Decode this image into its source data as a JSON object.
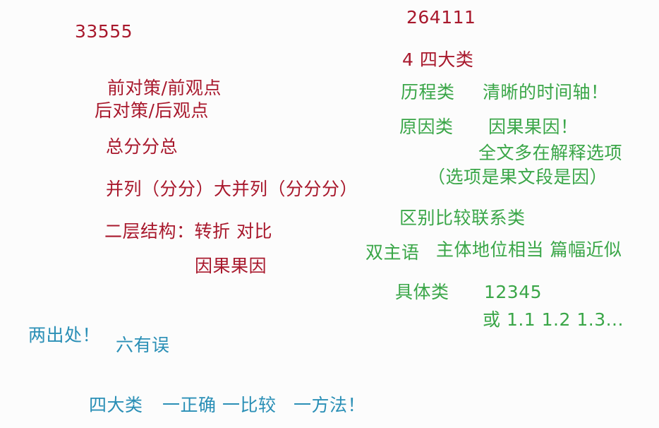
{
  "notes": {
    "left": {
      "num": "33555",
      "front_back_1": "前对策/前观点",
      "front_back_2": "后对策/后观点",
      "total_sub": "总分分总",
      "parallel": "并列（分分）大并列（分分分）",
      "two_layer": "二层结构：转折 对比",
      "cause_effect": "因果果因"
    },
    "right": {
      "num": "264111",
      "four_types": "4 四大类",
      "history_type": "历程类",
      "timeline": "清晰的时间轴！",
      "cause_type": "原因类",
      "cause_effect": "因果果因！",
      "explain_options": "全文多在解释选项",
      "options_note": "（选项是果文段是因）",
      "compare_type": "区别比较联系类",
      "dual_subject": "双主语",
      "equal_status": "主体地位相当 篇幅近似",
      "specific_type": "具体类",
      "seq": "12345",
      "seq_alt": "或 1.1 1.2 1.3..."
    },
    "bottom": {
      "two_sources": "两出处！",
      "six_errors": "六有误",
      "four_categories": "四大类",
      "one_correct": "一正确 一比较",
      "one_method": "一方法！"
    }
  },
  "colors": {
    "red": "#a8182c",
    "green": "#3aa648",
    "blue": "#2a8fb6",
    "background": "#fcfcfc"
  }
}
